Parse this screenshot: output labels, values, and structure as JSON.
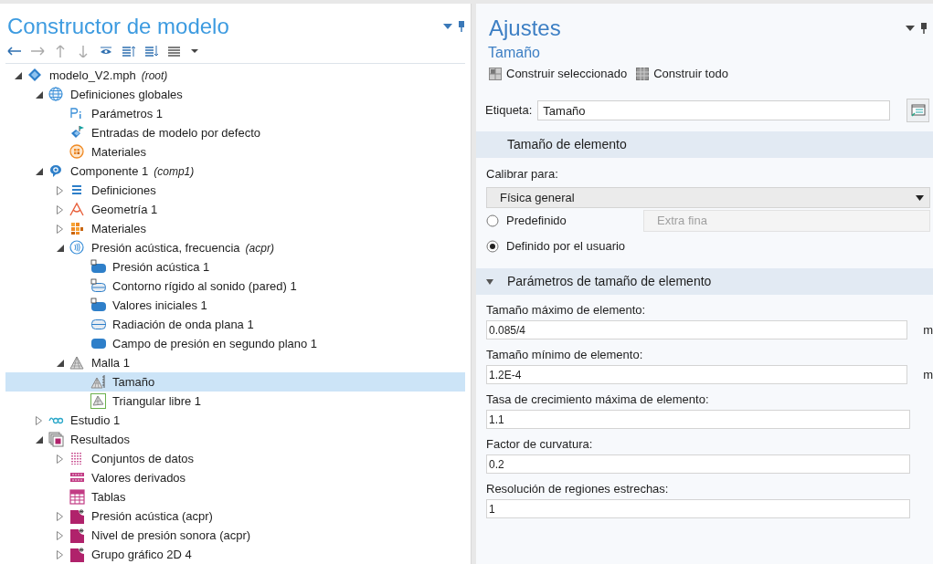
{
  "model_builder": {
    "title": "Constructor de modelo",
    "tree": [
      {
        "label": "modelo_V2.mph",
        "note": "(root)",
        "kind": "model",
        "expanded": true,
        "selected": false,
        "children": [
          {
            "label": "Definiciones globales",
            "kind": "globe",
            "expanded": true,
            "selected": false,
            "children": [
              {
                "label": "Parámetros 1",
                "kind": "params",
                "selected": false
              },
              {
                "label": "Entradas de modelo por defecto",
                "kind": "defaults",
                "selected": false
              },
              {
                "label": "Materiales",
                "kind": "material-circle",
                "selected": false
              }
            ]
          },
          {
            "label": "Componente 1",
            "note": "(comp1)",
            "kind": "component",
            "expanded": true,
            "selected": false,
            "children": [
              {
                "label": "Definiciones",
                "kind": "list",
                "expanded": false,
                "selected": false
              },
              {
                "label": "Geometría 1",
                "kind": "geometry",
                "expanded": false,
                "selected": false
              },
              {
                "label": "Materiales",
                "kind": "materials",
                "expanded": false,
                "selected": false
              },
              {
                "label": "Presión acústica, frecuencia",
                "note": "(acpr)",
                "kind": "acoustics",
                "expanded": true,
                "selected": false,
                "children": [
                  {
                    "label": "Presión acústica 1",
                    "kind": "domain-d",
                    "selected": false
                  },
                  {
                    "label": "Contorno rígido al sonido (pared) 1",
                    "kind": "boundary-d",
                    "selected": false
                  },
                  {
                    "label": "Valores iniciales 1",
                    "kind": "domain-d",
                    "selected": false
                  },
                  {
                    "label": "Radiación de onda plana 1",
                    "kind": "boundary",
                    "selected": false
                  },
                  {
                    "label": "Campo de presión en segundo plano 1",
                    "kind": "domain",
                    "selected": false
                  }
                ]
              },
              {
                "label": "Malla 1",
                "kind": "mesh",
                "expanded": true,
                "selected": false,
                "children": [
                  {
                    "label": "Tamaño",
                    "kind": "size",
                    "selected": true
                  },
                  {
                    "label": "Triangular libre 1",
                    "kind": "triangular",
                    "selected": false
                  }
                ]
              }
            ]
          },
          {
            "label": "Estudio 1",
            "kind": "study",
            "expanded": false,
            "selected": false
          },
          {
            "label": "Resultados",
            "kind": "results",
            "expanded": true,
            "selected": false,
            "children": [
              {
                "label": "Conjuntos de datos",
                "kind": "datasets",
                "expanded": false,
                "selected": false
              },
              {
                "label": "Valores derivados",
                "kind": "derived",
                "selected": false
              },
              {
                "label": "Tablas",
                "kind": "tables",
                "selected": false
              },
              {
                "label": "Presión acústica (acpr)",
                "kind": "plot",
                "expanded": false,
                "selected": false
              },
              {
                "label": "Nivel de presión sonora (acpr)",
                "kind": "plot",
                "expanded": false,
                "selected": false
              },
              {
                "label": "Grupo gráfico 2D 4",
                "kind": "plot",
                "expanded": false,
                "selected": false
              }
            ]
          }
        ]
      }
    ]
  },
  "settings": {
    "title": "Ajustes",
    "subtitle": "Tamaño",
    "toolbar": [
      "Construir seleccionado",
      "Construir todo"
    ],
    "label_field": {
      "label": "Etiqueta:",
      "value": "Tamaño"
    },
    "sections": [
      {
        "title": "Tamaño de elemento",
        "calibrate_label": "Calibrar para:",
        "calibrate_value": "Física general",
        "radios": [
          {
            "label": "Predefinido",
            "selected": false,
            "dropdown": "Extra fina"
          },
          {
            "label": "Definido por el usuario",
            "selected": true
          }
        ]
      },
      {
        "title": "Parámetros de tamaño de elemento",
        "expanded": true,
        "params": [
          {
            "label": "Tamaño máximo de elemento:",
            "value": "0.085/4",
            "unit": "m"
          },
          {
            "label": "Tamaño mínimo de elemento:",
            "value": "1.2E-4",
            "unit": "m"
          },
          {
            "label": "Tasa de crecimiento máxima de elemento:",
            "value": "1.1"
          },
          {
            "label": "Factor de curvatura:",
            "value": "0.2"
          },
          {
            "label": "Resolución de regiones estrechas:",
            "value": "1"
          }
        ]
      }
    ]
  }
}
